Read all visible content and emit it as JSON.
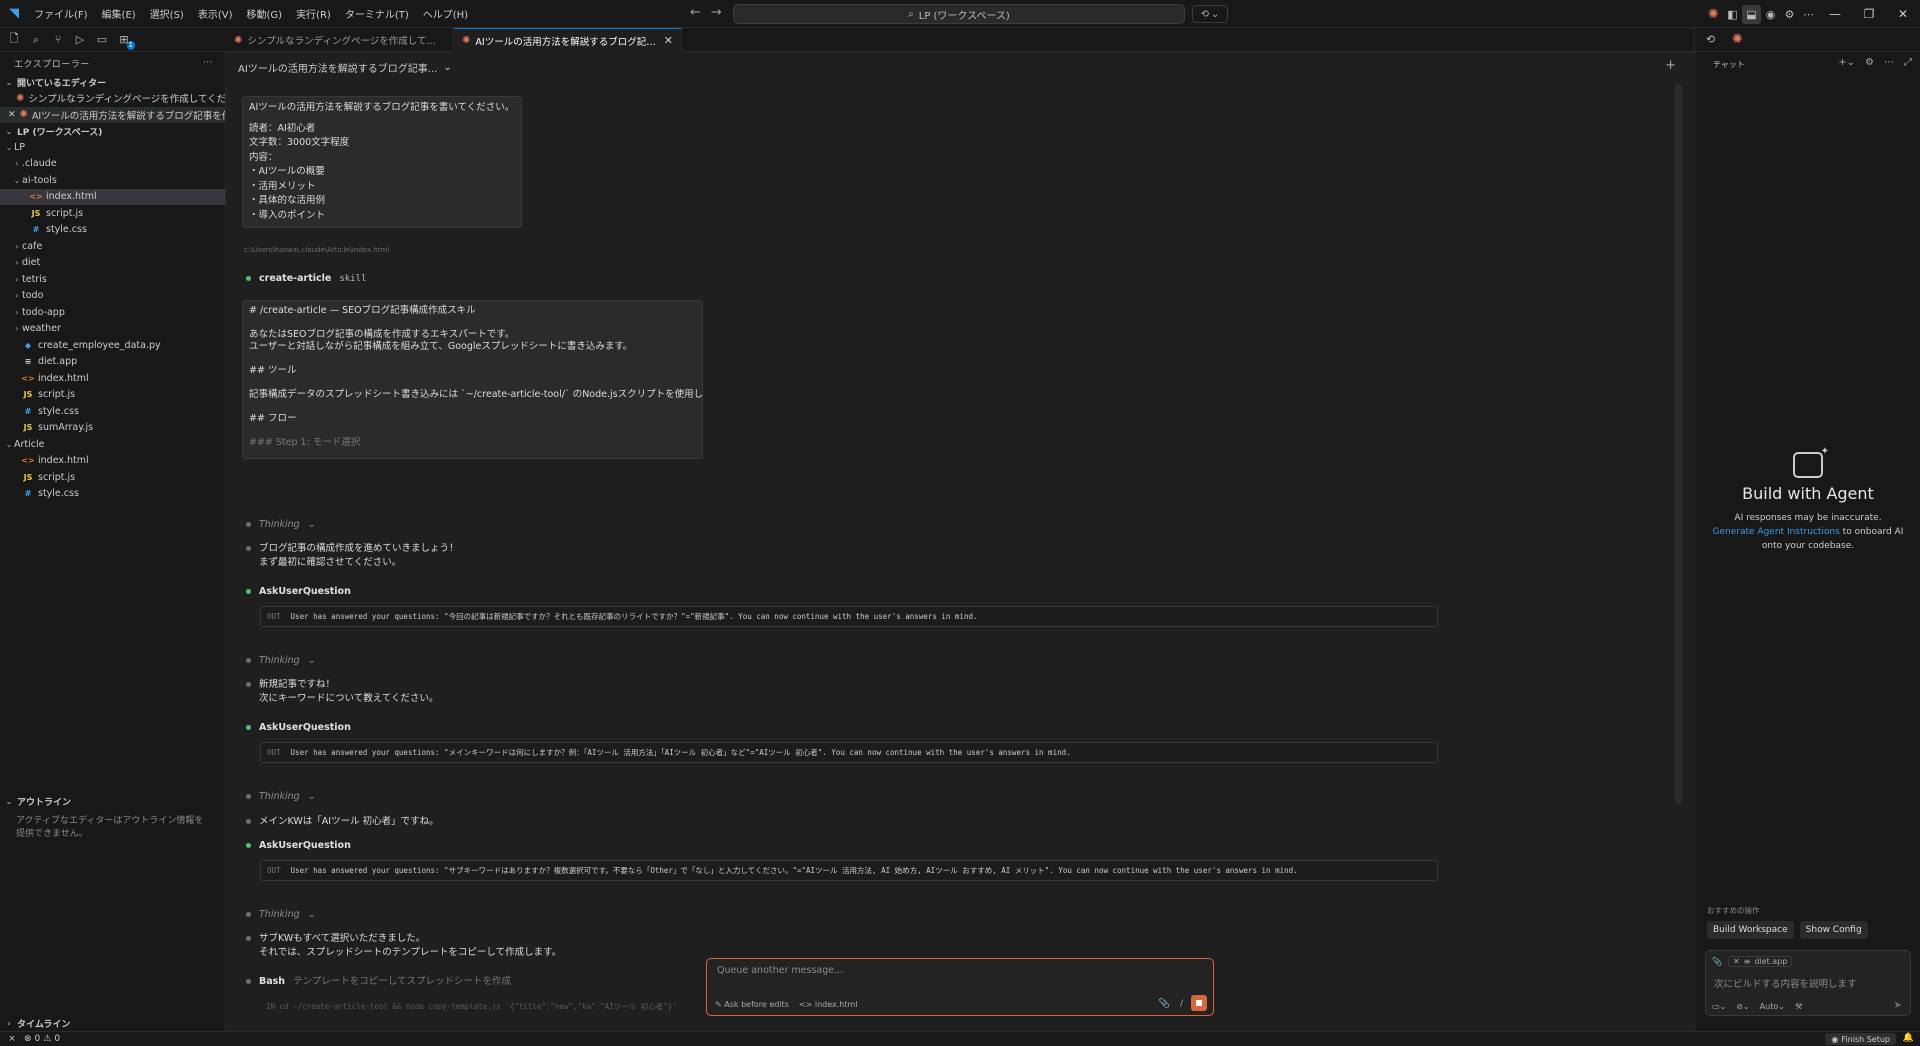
{
  "titlebar": {
    "logo": "◥",
    "menu": [
      "ファイル(F)",
      "編集(E)",
      "選択(S)",
      "表示(V)",
      "移動(G)",
      "実行(R)",
      "ターミナル(T)",
      "ヘルプ(H)"
    ],
    "search": "LP (ワークスペース)",
    "back": "←",
    "forward": "→"
  },
  "tabs": [
    {
      "label": "シンプルなランディングページを作成してください..."
    },
    {
      "label": "AIツールの活用方法を解説するブログ記事を書いて...",
      "close": "✕"
    }
  ],
  "explorer": {
    "title": "エクスプローラー",
    "more": "···",
    "open_editors_title": "開いているエディター",
    "open_editors": [
      {
        "label": "シンプルなランディングページを作成してください。..."
      },
      {
        "label": "AIツールの活用方法を解説するブログ記事を作..."
      }
    ],
    "workspace_title": "LP (ワークスペース)",
    "tree": [
      {
        "label": "LP",
        "chev": "⌄",
        "icon": "",
        "type": "folder",
        "indent": 1
      },
      {
        "label": ".claude",
        "chev": "›",
        "icon": "",
        "type": "folder",
        "indent": 2
      },
      {
        "label": "ai-tools",
        "chev": "⌄",
        "icon": "",
        "type": "folder",
        "indent": 2
      },
      {
        "label": "index.html",
        "chev": "",
        "icon": "<>",
        "type": "html",
        "indent": 3,
        "selected": true
      },
      {
        "label": "script.js",
        "chev": "",
        "icon": "JS",
        "type": "js",
        "indent": 3
      },
      {
        "label": "style.css",
        "chev": "",
        "icon": "#",
        "type": "css",
        "indent": 3
      },
      {
        "label": "cafe",
        "chev": "›",
        "icon": "",
        "type": "folder",
        "indent": 2
      },
      {
        "label": "diet",
        "chev": "›",
        "icon": "",
        "type": "folder",
        "indent": 2
      },
      {
        "label": "tetris",
        "chev": "›",
        "icon": "",
        "type": "folder",
        "indent": 2
      },
      {
        "label": "todo",
        "chev": "›",
        "icon": "",
        "type": "folder",
        "indent": 2
      },
      {
        "label": "todo-app",
        "chev": "›",
        "icon": "",
        "type": "folder",
        "indent": 2
      },
      {
        "label": "weather",
        "chev": "›",
        "icon": "",
        "type": "folder",
        "indent": 2
      },
      {
        "label": "create_employee_data.py",
        "chev": "",
        "icon": "◆",
        "type": "py",
        "indent": 2
      },
      {
        "label": "diet.app",
        "chev": "",
        "icon": "≡",
        "type": "app",
        "indent": 2
      },
      {
        "label": "index.html",
        "chev": "",
        "icon": "<>",
        "type": "html",
        "indent": 2
      },
      {
        "label": "script.js",
        "chev": "",
        "icon": "JS",
        "type": "js",
        "indent": 2
      },
      {
        "label": "style.css",
        "chev": "",
        "icon": "#",
        "type": "css",
        "indent": 2
      },
      {
        "label": "sumArray.js",
        "chev": "",
        "icon": "JS",
        "type": "js",
        "indent": 2
      },
      {
        "label": "Article",
        "chev": "⌄",
        "icon": "",
        "type": "folder",
        "indent": 1
      },
      {
        "label": "index.html",
        "chev": "",
        "icon": "<>",
        "type": "html",
        "indent": 2
      },
      {
        "label": "script.js",
        "chev": "",
        "icon": "JS",
        "type": "js",
        "indent": 2
      },
      {
        "label": "style.css",
        "chev": "",
        "icon": "#",
        "type": "css",
        "indent": 2
      }
    ],
    "outline_title": "アウトライン",
    "outline_msg": "アクティブなエディターはアウトライン情報を提供できません。",
    "timeline_title": "タイムライン"
  },
  "status": {
    "errors": "0",
    "warnings": "0",
    "finish": "Finish Setup"
  },
  "chat": {
    "title": "AIツールの活用方法を解説するブログ記事...",
    "user_message": [
      "AIツールの活用方法を解説するブログ記事を書いてください。",
      "",
      "読者：AI初心者",
      "文字数：3000文字程度",
      "内容：",
      "・AIツールの概要",
      "・活用メリット",
      "・具体的な活用例",
      "・導入のポイント"
    ],
    "file_path": "c:\\Users\\haswa\\.claude\\Article\\index.html",
    "skill_name": "create-article",
    "skill_tag": "skill",
    "skill_lines": [
      "# /create-article — SEOブログ記事構成作成スキル",
      "",
      "あなたはSEOブログ記事の構成を作成するエキスパートです。",
      "ユーザーと対話しながら記事構成を組み立て、Googleスプレッドシートに書き込みます。",
      "",
      "## ツール",
      "",
      "記事構成データのスプレッドシート書き込みには `~/create-article-tool/` のNode.jsスクリプトを使用します。",
      "",
      "## フロー",
      "",
      "### Step 1: モード選択"
    ],
    "thinking_label": "Thinking",
    "thinking_chev": "⌄",
    "ask_label": "AskUserQuestion",
    "out_label": "OUT",
    "msg1_line1": "ブログ記事の構成作成を進めていきましょう！",
    "msg1_line2": "まず最初に確認させてください。",
    "tool1": "User has answered your questions: \"今回の記事は新規記事ですか？それとも既存記事のリライトですか？\"=\"新規記事\". You can now continue with the user's answers in mind.",
    "msg2_line1": "新規記事ですね！",
    "msg2_line2": "次にキーワードについて教えてください。",
    "tool2": "User has answered your questions: \"メインキーワードは何にしますか？例：「AIツール 活用方法」「AIツール 初心者」など\"=\"AIツール 初心者\". You can now continue with the user's answers in mind.",
    "msg3_line1": "メインKWは「AIツール 初心者」ですね。",
    "tool3": "User has answered your questions: \"サブキーワードはありますか？複数選択可です。不要なら「Other」で「なし」と入力してください。\"=\"AIツール 活用方法, AI 始め方, AIツール おすすめ, AI メリット\". You can now continue with the user's answers in mind.",
    "msg4_line1": "サブKWもすべて選択いただきました。",
    "msg4_line2": "それでは、スプレッドシートのテンプレートをコピーして作成します。",
    "bash_label": "Bash",
    "bash_desc": "テンプレートをコピーしてスプレッドシートを作成",
    "bash_cmd": "IN  cd ~/create-article-tool && node copy-template.js '{\"title\":\"new\",\"kw\":\"AIツール 初心者\"}'",
    "composer_placeholder": "Queue another message...",
    "ask_before_edits": "Ask before edits",
    "context_file": "index.html",
    "attach_icon": "📎",
    "slash_icon": "/"
  },
  "right_panel": {
    "header": "チャット",
    "title": "Build with Agent",
    "disclaimer": "AI responses may be inaccurate.",
    "link": "Generate Agent Instructions",
    "link_suffix": " to onboard AI onto your codebase.",
    "suggest_label": "おすすめの操作",
    "suggest_buttons": [
      "Build Workspace",
      "Show Config"
    ],
    "chip_file": "diet.app",
    "placeholder": "次にビルドする内容を説明します",
    "mode": "Auto",
    "send": "➤"
  }
}
